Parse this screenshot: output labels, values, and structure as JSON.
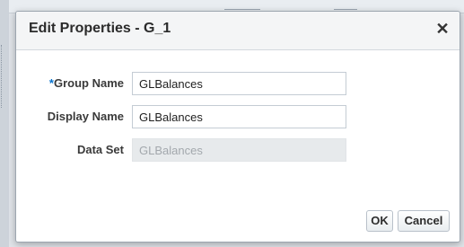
{
  "dialog": {
    "title": "Edit Properties - G_1",
    "close_icon_glyph": "✕"
  },
  "form": {
    "group_name": {
      "required_marker": "*",
      "label": "Group Name",
      "value": "GLBalances"
    },
    "display_name": {
      "label": "Display Name",
      "value": "GLBalances"
    },
    "data_set": {
      "label": "Data Set",
      "value": "GLBalances",
      "disabled": true
    }
  },
  "buttons": {
    "ok_label": "OK",
    "cancel_label": "Cancel"
  },
  "colors": {
    "required_marker": "#0572ce",
    "header_background": "#f4f5f6",
    "disabled_field_background": "#e7eaec"
  }
}
